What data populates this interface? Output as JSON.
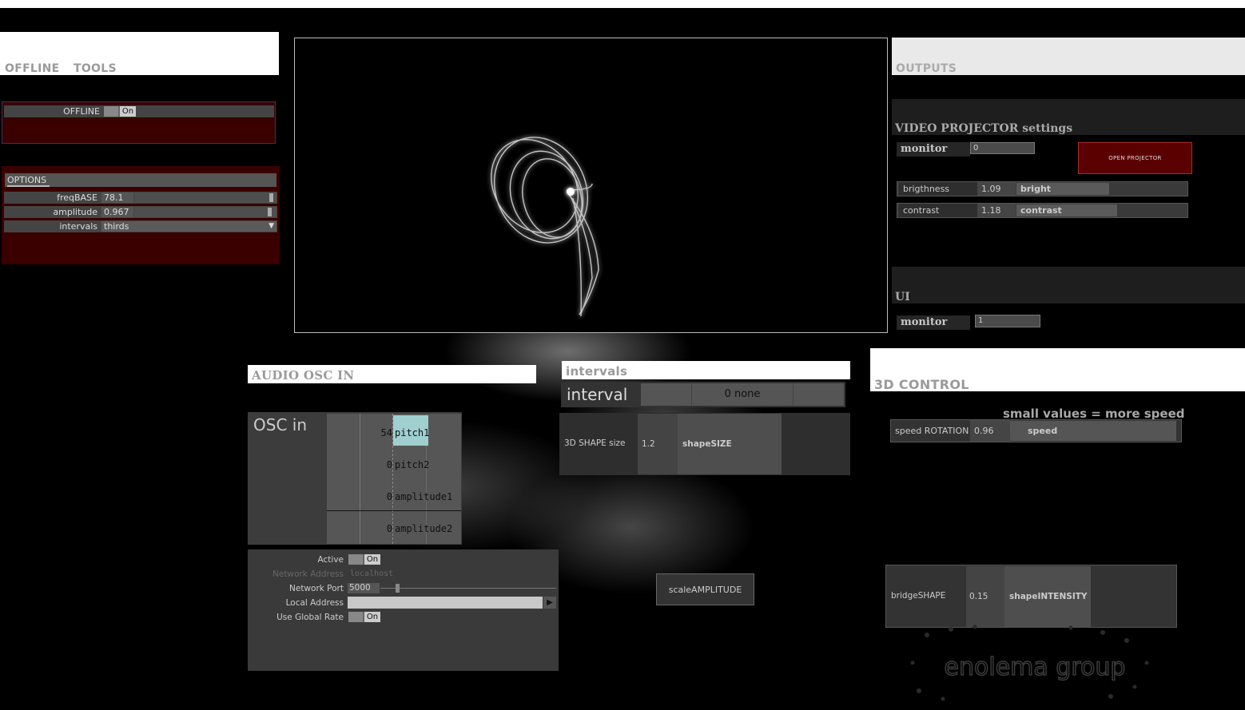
{
  "left": {
    "tabs": [
      "OFFLINE",
      "TOOLS"
    ],
    "offline": {
      "label": "OFFLINE",
      "toggle": "On"
    },
    "options": {
      "tab": "OPTIONS",
      "freqBASE": {
        "label": "freqBASE",
        "value": "78.1",
        "fraction": 0.98
      },
      "amplitude": {
        "label": "amplitude",
        "value": "0.967",
        "fraction": 0.97
      },
      "intervals": {
        "label": "intervals",
        "value": "thirds"
      }
    }
  },
  "outputs": {
    "header": "OUTPUTS",
    "video": {
      "title": "VIDEO PROJECTOR settings",
      "monitor_label": "monitor",
      "monitor_value": "0",
      "open_button": "OPEN PROJECTOR",
      "brightness": {
        "label": "brigthness",
        "value": "1.09",
        "name": "bright",
        "fraction": 0.54
      },
      "contrast": {
        "label": "contrast",
        "value": "1.18",
        "name": "contrast",
        "fraction": 0.59
      }
    },
    "ui": {
      "title": "UI",
      "monitor_label": "monitor",
      "monitor_value": "1"
    }
  },
  "audio": {
    "header": "AUDIO OSC IN",
    "osc_label": "OSC in",
    "channels": [
      {
        "value": "54",
        "name": "pitch1"
      },
      {
        "value": "0",
        "name": "pitch2"
      },
      {
        "value": "0",
        "name": "amplitude1"
      },
      {
        "value": "0",
        "name": "amplitude2"
      }
    ],
    "network": {
      "active_label": "Active",
      "active": "On",
      "address_label": "Network Address",
      "address": "localhost",
      "port_label": "Network Port",
      "port": "5000",
      "local_label": "Local Address",
      "global_label": "Use Global Rate",
      "global": "On"
    }
  },
  "intervals": {
    "header": "intervals",
    "interval_label": "interval",
    "interval_value": "0 none",
    "shape": {
      "label": "3D SHAPE size",
      "value": "1.2",
      "name": "shapeSIZE"
    },
    "scale_button": "scaleAMPLITUDE"
  },
  "control": {
    "header": "3D CONTROL",
    "note": "small values = more speed",
    "speed": {
      "label": "speed ROTATION",
      "value": "0.96",
      "name": "speed",
      "fraction": 0.97
    },
    "bridge": {
      "label": "bridgeSHAPE",
      "value": "0.15",
      "name": "shapeINTENSITY"
    }
  },
  "logo_text": "enolema group",
  "colors": {
    "panel_red": "#3a0000",
    "highlight": "#9fcfcf",
    "button_red": "#5a0000"
  }
}
